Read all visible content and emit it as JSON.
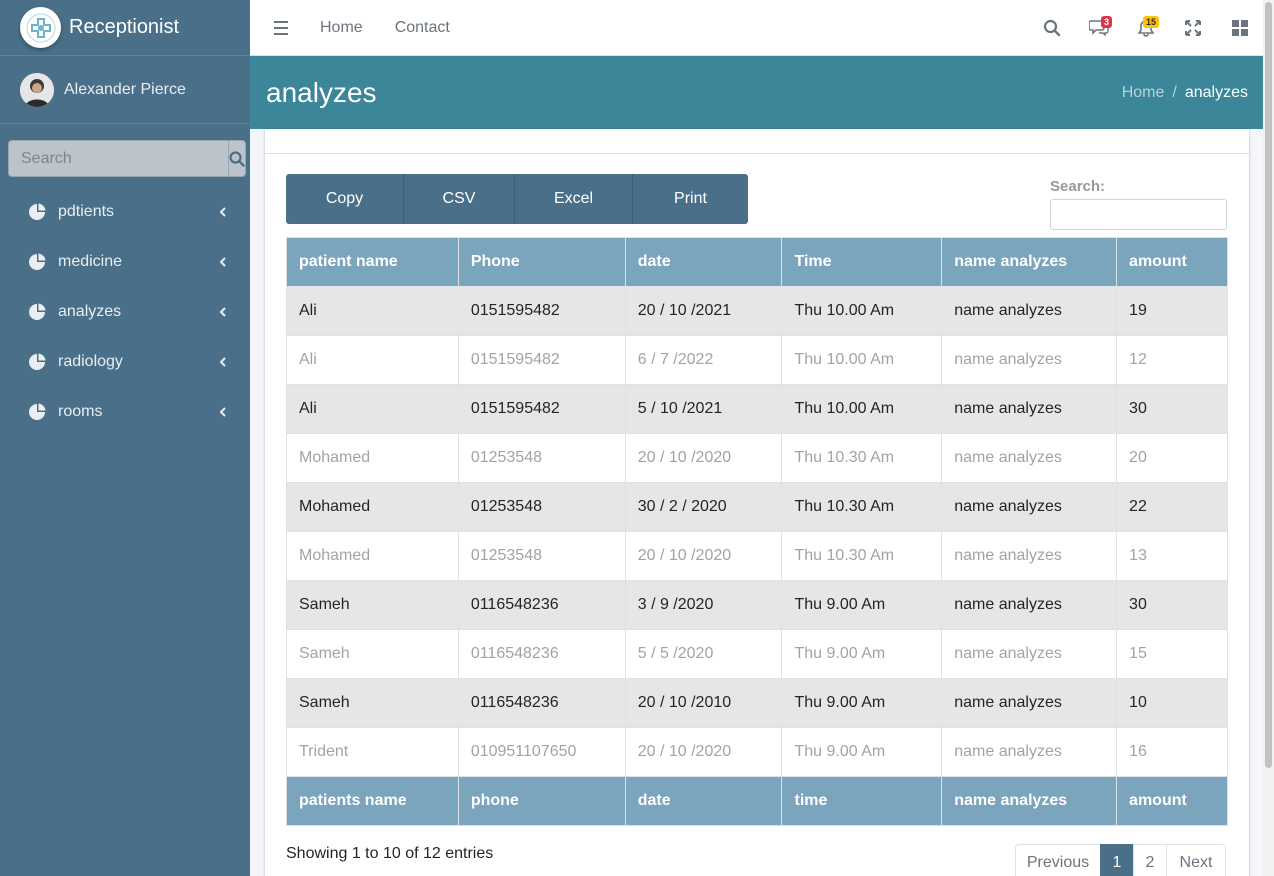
{
  "brand": {
    "name": "Receptionist"
  },
  "user": {
    "name": "Alexander Pierce"
  },
  "sidebar": {
    "search_placeholder": "Search",
    "items": [
      {
        "label": "pdtients"
      },
      {
        "label": "medicine"
      },
      {
        "label": "analyzes"
      },
      {
        "label": "radiology"
      },
      {
        "label": "rooms"
      }
    ]
  },
  "topbar": {
    "home": "Home",
    "contact": "Contact",
    "messages_count": "3",
    "notifications_count": "15"
  },
  "header": {
    "title": "analyzes",
    "breadcrumb_home": "Home",
    "breadcrumb_sep": "/",
    "breadcrumb_current": "analyzes"
  },
  "toolbar": {
    "copy": "Copy",
    "csv": "CSV",
    "excel": "Excel",
    "print": "Print",
    "search_label": "Search:"
  },
  "table": {
    "headers": [
      "patient name",
      "Phone",
      "date",
      "Time",
      "name analyzes",
      "amount"
    ],
    "footers": [
      "patients name",
      "phone",
      "date",
      "time",
      "name analyzes",
      "amount"
    ],
    "rows": [
      [
        "Ali",
        "0151595482",
        "20 / 10 /2021",
        "Thu 10.00 Am",
        "name analyzes",
        "19"
      ],
      [
        "Ali",
        "0151595482",
        "6 / 7 /2022",
        "Thu 10.00 Am",
        "name analyzes",
        "12"
      ],
      [
        "Ali",
        "0151595482",
        "5 / 10 /2021",
        "Thu 10.00 Am",
        "name analyzes",
        "30"
      ],
      [
        "Mohamed",
        "01253548",
        "20 / 10 /2020",
        "Thu 10.30 Am",
        "name analyzes",
        "20"
      ],
      [
        "Mohamed",
        "01253548",
        "30 / 2 / 2020",
        "Thu 10.30 Am",
        "name analyzes",
        "22"
      ],
      [
        "Mohamed",
        "01253548",
        "20 / 10 /2020",
        "Thu 10.30 Am",
        "name analyzes",
        "13"
      ],
      [
        "Sameh",
        "0116548236",
        "3 / 9 /2020",
        "Thu 9.00 Am",
        "name analyzes",
        "30"
      ],
      [
        "Sameh",
        "0116548236",
        "5 / 5 /2020",
        "Thu 9.00 Am",
        "name analyzes",
        "15"
      ],
      [
        "Sameh",
        "0116548236",
        "20 / 10 /2010",
        "Thu 9.00 Am",
        "name analyzes",
        "10"
      ],
      [
        "Trident",
        "010951107650",
        "20 / 10 /2020",
        "Thu 9.00 Am",
        "name analyzes",
        "16"
      ]
    ]
  },
  "footer_info": "Showing 1 to 10 of 12 entries",
  "pagination": {
    "previous": "Previous",
    "pages": [
      "1",
      "2"
    ],
    "next": "Next"
  },
  "colors": {
    "sidebar": "#4a7089",
    "header": "#3b8699",
    "table_head": "#7aa5bd"
  }
}
